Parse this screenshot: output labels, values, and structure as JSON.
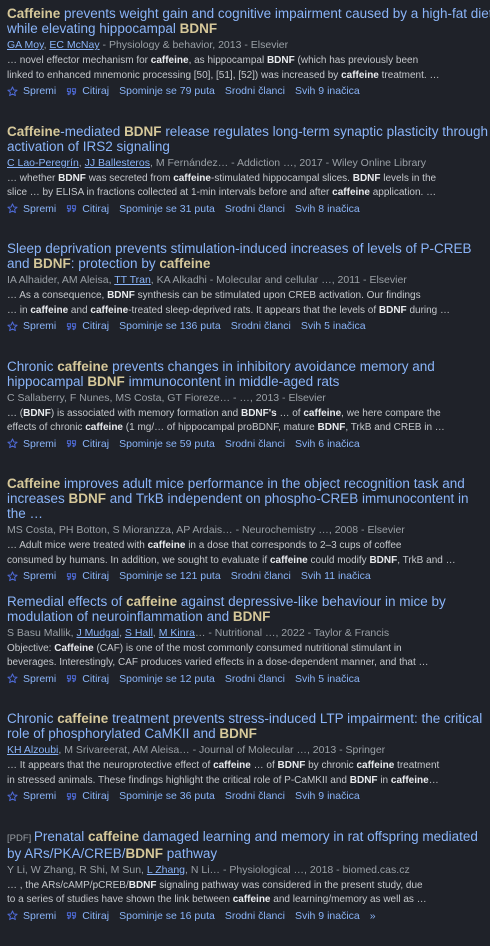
{
  "labels": {
    "save": "Spremi",
    "cite": "Citiraj",
    "related": "Srodni članci"
  },
  "colors": {
    "background": "#1f2229",
    "link": "#8ab4f8",
    "highlight": "#d6c89a",
    "meta": "#9aa0a6"
  },
  "results": [
    {
      "title_lines": [
        [
          {
            "t": "Caffeine",
            "b": true
          },
          {
            "t": " prevents weight gain and cognitive impairment caused by a high-fat diet"
          }
        ],
        [
          {
            "t": "while elevating hippocampal "
          },
          {
            "t": "BDNF",
            "b": true
          }
        ]
      ],
      "authors": [
        {
          "t": "GA Moy",
          "link": true
        },
        {
          "t": ", "
        },
        {
          "t": "EC McNay",
          "link": true
        },
        {
          "t": " - Physiology & behavior, 2013 - Elsevier"
        }
      ],
      "snippet_lines": [
        [
          {
            "t": "… novel effector mechanism for "
          },
          {
            "t": "caffeine",
            "b": true
          },
          {
            "t": ", as hippocampal "
          },
          {
            "t": "BDNF",
            "b": true
          },
          {
            "t": " (which has previously been"
          }
        ],
        [
          {
            "t": "linked to enhanced mnemonic processing [50], [51], [52]) was increased by "
          },
          {
            "t": "caffeine",
            "b": true
          },
          {
            "t": " treatment. …"
          }
        ]
      ],
      "cited_by": "Spominje se 79 puta",
      "versions": "Svih 9 inačica"
    },
    {
      "title_lines": [
        [
          {
            "t": "Caffeine",
            "b": true
          },
          {
            "t": "-mediated "
          },
          {
            "t": "BDNF",
            "b": true
          },
          {
            "t": " release regulates long-term synaptic plasticity through"
          }
        ],
        [
          {
            "t": "activation of IRS2 signaling"
          }
        ]
      ],
      "authors": [
        {
          "t": "C Lao-Peregrín",
          "link": true
        },
        {
          "t": ", "
        },
        {
          "t": "JJ Ballesteros",
          "link": true
        },
        {
          "t": ", M Fernández… - Addiction …, 2017 - Wiley Online Library"
        }
      ],
      "snippet_lines": [
        [
          {
            "t": "… whether "
          },
          {
            "t": "BDNF",
            "b": true
          },
          {
            "t": " was secreted from "
          },
          {
            "t": "caffeine",
            "b": true
          },
          {
            "t": "-stimulated hippocampal slices. "
          },
          {
            "t": "BDNF",
            "b": true
          },
          {
            "t": " levels in the"
          }
        ],
        [
          {
            "t": "slice … by ELISA in fractions collected at 1-min intervals before and after "
          },
          {
            "t": "caffeine",
            "b": true
          },
          {
            "t": " application. …"
          }
        ]
      ],
      "cited_by": "Spominje se 31 puta",
      "versions": "Svih 8 inačica"
    },
    {
      "title_lines": [
        [
          {
            "t": "Sleep deprivation prevents stimulation-induced increases of levels of P-CREB"
          }
        ],
        [
          {
            "t": "and "
          },
          {
            "t": "BDNF",
            "b": true
          },
          {
            "t": ": protection by "
          },
          {
            "t": "caffeine",
            "b": true
          }
        ]
      ],
      "authors": [
        {
          "t": "IA Alhaider, AM Aleisa, "
        },
        {
          "t": "TT Tran",
          "link": true
        },
        {
          "t": ", KA Alkadhi - Molecular and cellular …, 2011 - Elsevier"
        }
      ],
      "snippet_lines": [
        [
          {
            "t": "… As a consequence, "
          },
          {
            "t": "BDNF",
            "b": true
          },
          {
            "t": " synthesis can be stimulated upon CREB activation. Our findings"
          }
        ],
        [
          {
            "t": "… in "
          },
          {
            "t": "caffeine",
            "b": true
          },
          {
            "t": " and "
          },
          {
            "t": "caffeine",
            "b": true
          },
          {
            "t": "-treated sleep-deprived rats. It appears that the levels of "
          },
          {
            "t": "BDNF",
            "b": true
          },
          {
            "t": " during …"
          }
        ]
      ],
      "cited_by": "Spominje se 136 puta",
      "versions": "Svih 5 inačica"
    },
    {
      "title_lines": [
        [
          {
            "t": "Chronic "
          },
          {
            "t": "caffeine",
            "b": true
          },
          {
            "t": " prevents changes in inhibitory avoidance memory and"
          }
        ],
        [
          {
            "t": "hippocampal "
          },
          {
            "t": "BDNF",
            "b": true
          },
          {
            "t": " immunocontent in middle-aged rats"
          }
        ]
      ],
      "authors": [
        {
          "t": "C Sallaberry, F Nunes, MS Costa, GT Fioreze… - …, 2013 - Elsevier"
        }
      ],
      "snippet_lines": [
        [
          {
            "t": "… ("
          },
          {
            "t": "BDNF",
            "b": true
          },
          {
            "t": ") is associated with memory formation and "
          },
          {
            "t": "BDNF's",
            "b": true
          },
          {
            "t": " … of "
          },
          {
            "t": "caffeine",
            "b": true
          },
          {
            "t": ", we here compare the"
          }
        ],
        [
          {
            "t": "effects of chronic "
          },
          {
            "t": "caffeine",
            "b": true
          },
          {
            "t": " (1 mg/… of hippocampal proBDNF, mature "
          },
          {
            "t": "BDNF",
            "b": true
          },
          {
            "t": ", TrkB and CREB in …"
          }
        ]
      ],
      "cited_by": "Spominje se 59 puta",
      "versions": "Svih 6 inačica"
    },
    {
      "title_lines": [
        [
          {
            "t": "Caffeine",
            "b": true
          },
          {
            "t": " improves adult mice performance in the object recognition task and"
          }
        ],
        [
          {
            "t": "increases "
          },
          {
            "t": "BDNF",
            "b": true
          },
          {
            "t": " and TrkB independent on phospho-CREB immunocontent in"
          }
        ],
        [
          {
            "t": "the …"
          }
        ]
      ],
      "authors": [
        {
          "t": "MS Costa, PH Botton, S Mioranzza, AP Ardais… - Neurochemistry …, 2008 - Elsevier"
        }
      ],
      "snippet_lines": [
        [
          {
            "t": "… Adult mice were treated with "
          },
          {
            "t": "caffeine",
            "b": true
          },
          {
            "t": " in a dose that corresponds to 2–3 cups of coffee"
          }
        ],
        [
          {
            "t": "consumed by humans. In addition, we sought to evaluate if "
          },
          {
            "t": "caffeine",
            "b": true
          },
          {
            "t": " could modify "
          },
          {
            "t": "BDNF",
            "b": true
          },
          {
            "t": ", TrkB and …"
          }
        ]
      ],
      "cited_by": "Spominje se 121 puta",
      "versions": "Svih 11 inačica"
    },
    {
      "title_lines": [
        [
          {
            "t": "Remedial effects of "
          },
          {
            "t": "caffeine",
            "b": true
          },
          {
            "t": " against depressive-like behaviour in mice by"
          }
        ],
        [
          {
            "t": "modulation of neuroinflammation and "
          },
          {
            "t": "BDNF",
            "b": true
          }
        ]
      ],
      "authors": [
        {
          "t": "S Basu Mallik, "
        },
        {
          "t": "J Mudgal",
          "link": true
        },
        {
          "t": ", "
        },
        {
          "t": "S Hall",
          "link": true
        },
        {
          "t": ", "
        },
        {
          "t": "M Kinra",
          "link": true
        },
        {
          "t": "… - Nutritional …, 2022 - Taylor & Francis"
        }
      ],
      "snippet_lines": [
        [
          {
            "t": "Objective: "
          },
          {
            "t": "Caffeine",
            "b": true
          },
          {
            "t": " (CAF) is one of the most commonly consumed nutritional stimulant in"
          }
        ],
        [
          {
            "t": "beverages. Interestingly, CAF produces varied effects in a dose-dependent manner, and that …"
          }
        ]
      ],
      "cited_by": "Spominje se 12 puta",
      "versions": "Svih 5 inačica"
    },
    {
      "title_lines": [
        [
          {
            "t": "Chronic "
          },
          {
            "t": "caffeine",
            "b": true
          },
          {
            "t": " treatment prevents stress-induced LTP impairment: the critical"
          }
        ],
        [
          {
            "t": "role of phosphorylated CaMKII and "
          },
          {
            "t": "BDNF",
            "b": true
          }
        ]
      ],
      "authors": [
        {
          "t": "KH Alzoubi",
          "link": true
        },
        {
          "t": ", M Srivareerat, AM Aleisa… - Journal of Molecular …, 2013 - Springer"
        }
      ],
      "snippet_lines": [
        [
          {
            "t": "… It appears that the neuroprotective effect of "
          },
          {
            "t": "caffeine",
            "b": true
          },
          {
            "t": " … of "
          },
          {
            "t": "BDNF",
            "b": true
          },
          {
            "t": " by chronic "
          },
          {
            "t": "caffeine",
            "b": true
          },
          {
            "t": " treatment"
          }
        ],
        [
          {
            "t": "in stressed animals. These findings highlight the critical role of P-CaMKII and "
          },
          {
            "t": "BDNF",
            "b": true
          },
          {
            "t": " in "
          },
          {
            "t": "caffeine",
            "b": true
          },
          {
            "t": "…"
          }
        ]
      ],
      "cited_by": "Spominje se 36 puta",
      "versions": "Svih 9 inačica"
    },
    {
      "title_lines": [
        [
          {
            "t": "[PDF] ",
            "pdf": true
          },
          {
            "t": "Prenatal "
          },
          {
            "t": "caffeine",
            "b": true
          },
          {
            "t": " damaged learning and memory in rat offspring mediated"
          }
        ],
        [
          {
            "t": "by ARs/PKA/CREB/"
          },
          {
            "t": "BDNF",
            "b": true
          },
          {
            "t": " pathway"
          }
        ]
      ],
      "authors": [
        {
          "t": "Y Li, W Zhang, R Shi, M Sun, "
        },
        {
          "t": "L Zhang",
          "link": true
        },
        {
          "t": ", N Li… - Physiological …, 2018 - biomed.cas.cz"
        }
      ],
      "snippet_lines": [
        [
          {
            "t": "… , the ARs/cAMP/pCREB/"
          },
          {
            "t": "BDNF",
            "b": true
          },
          {
            "t": " signaling pathway was considered in the present study, due"
          }
        ],
        [
          {
            "t": "to a series of studies have shown the link between "
          },
          {
            "t": "caffeine",
            "b": true
          },
          {
            "t": " and learning/memory as well as …"
          }
        ]
      ],
      "cited_by": "Spominje se 16 puta",
      "versions": "Svih 9 inačica",
      "more": "»"
    }
  ]
}
